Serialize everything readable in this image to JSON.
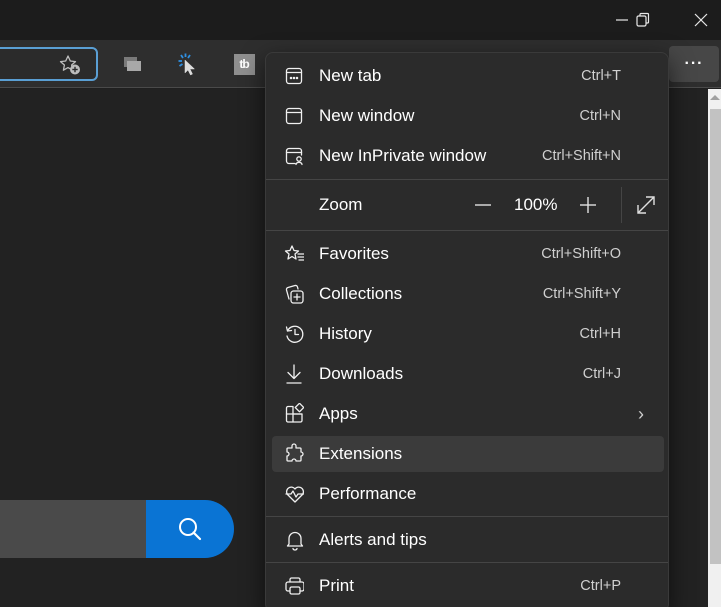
{
  "window_controls": {
    "minimize": "minimize",
    "restore": "restore",
    "close": "close"
  },
  "toolbar": {
    "favorite_add_icon": "star-plus-icon",
    "extensions": [
      {
        "name": "tab-manager-extension",
        "icon": "stacked-windows-icon"
      },
      {
        "name": "cursor-extension",
        "icon": "cursor-click-icon"
      },
      {
        "name": "tb-extension",
        "icon": "tb-logo-icon",
        "text": "tb"
      }
    ],
    "more_button": "···"
  },
  "menu": {
    "items_top": [
      {
        "id": "new-tab",
        "label": "New tab",
        "shortcut": "Ctrl+T",
        "icon": "new-tab-icon"
      },
      {
        "id": "new-window",
        "label": "New window",
        "shortcut": "Ctrl+N",
        "icon": "window-icon"
      },
      {
        "id": "new-inprivate",
        "label": "New InPrivate window",
        "shortcut": "Ctrl+Shift+N",
        "icon": "inprivate-icon"
      }
    ],
    "zoom": {
      "label": "Zoom",
      "value": "100%",
      "minus": "−",
      "plus": "+"
    },
    "items_mid": [
      {
        "id": "favorites",
        "label": "Favorites",
        "shortcut": "Ctrl+Shift+O",
        "icon": "favorites-icon"
      },
      {
        "id": "collections",
        "label": "Collections",
        "shortcut": "Ctrl+Shift+Y",
        "icon": "collections-icon"
      },
      {
        "id": "history",
        "label": "History",
        "shortcut": "Ctrl+H",
        "icon": "history-icon"
      },
      {
        "id": "downloads",
        "label": "Downloads",
        "shortcut": "Ctrl+J",
        "icon": "download-icon"
      },
      {
        "id": "apps",
        "label": "Apps",
        "shortcut": "",
        "icon": "apps-icon",
        "submenu": true,
        "chevron": "›"
      },
      {
        "id": "extensions",
        "label": "Extensions",
        "shortcut": "",
        "icon": "puzzle-icon",
        "hovered": true
      },
      {
        "id": "performance",
        "label": "Performance",
        "shortcut": "",
        "icon": "heart-pulse-icon"
      }
    ],
    "items_alerts": [
      {
        "id": "alerts",
        "label": "Alerts and tips",
        "shortcut": "",
        "icon": "bell-icon"
      }
    ],
    "items_bottom": [
      {
        "id": "print",
        "label": "Print",
        "shortcut": "Ctrl+P",
        "icon": "printer-icon"
      }
    ]
  },
  "page": {
    "search_button_icon": "search-icon",
    "search_accent": "#0a74d4"
  }
}
